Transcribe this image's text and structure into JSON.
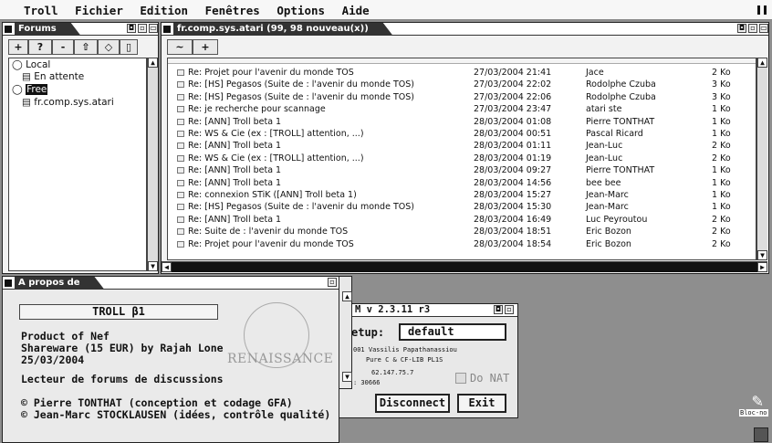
{
  "menubar": {
    "items": [
      "Troll",
      "Fichier",
      "Edition",
      "Fenêtres",
      "Options",
      "Aide"
    ]
  },
  "forums_window": {
    "title": "Forums",
    "toolbar": [
      "+",
      "?",
      "-"
    ],
    "tree": [
      "Local",
      "En attente",
      "Free",
      "fr.comp.sys.atari"
    ]
  },
  "list_window": {
    "title": "fr.comp.sys.atari (99, 98 nouveau(x))",
    "toolbar": [
      "~",
      "+"
    ],
    "rows": [
      {
        "subject": "Re: Projet pour l'avenir du monde TOS",
        "date": "27/03/2004 21:41",
        "author": "Jace",
        "size": "2 Ko"
      },
      {
        "subject": "Re: [HS] Pegasos (Suite de : l'avenir du monde TOS)",
        "date": "27/03/2004 22:02",
        "author": "Rodolphe Czuba",
        "size": "3 Ko"
      },
      {
        "subject": "Re: [HS] Pegasos (Suite de : l'avenir du monde TOS)",
        "date": "27/03/2004 22:06",
        "author": "Rodolphe Czuba",
        "size": "3 Ko"
      },
      {
        "subject": "Re: je recherche pour scannage",
        "date": "27/03/2004 23:47",
        "author": "atari ste",
        "size": "1 Ko"
      },
      {
        "subject": "Re: [ANN] Troll beta 1",
        "date": "28/03/2004 01:08",
        "author": "Pierre TONTHAT",
        "size": "1 Ko"
      },
      {
        "subject": "Re: WS & Cie (ex : [TROLL] attention, ...)",
        "date": "28/03/2004 00:51",
        "author": "Pascal Ricard",
        "size": "1 Ko"
      },
      {
        "subject": "Re: [ANN] Troll beta 1",
        "date": "28/03/2004 01:11",
        "author": "Jean-Luc",
        "size": "2 Ko"
      },
      {
        "subject": "Re: WS & Cie (ex : [TROLL] attention, ...)",
        "date": "28/03/2004 01:19",
        "author": "Jean-Luc",
        "size": "2 Ko"
      },
      {
        "subject": "Re: [ANN] Troll beta 1",
        "date": "28/03/2004 09:27",
        "author": "Pierre TONTHAT",
        "size": "1 Ko"
      },
      {
        "subject": "Re: [ANN] Troll beta 1",
        "date": "28/03/2004 14:56",
        "author": "bee bee",
        "size": "1 Ko"
      },
      {
        "subject": "Re: connexion STiK ([ANN] Troll beta 1)",
        "date": "28/03/2004 15:27",
        "author": "Jean-Marc",
        "size": "1 Ko"
      },
      {
        "subject": "Re: [HS] Pegasos (Suite de : l'avenir du monde TOS)",
        "date": "28/03/2004 15:30",
        "author": "Jean-Marc",
        "size": "1 Ko"
      },
      {
        "subject": "Re: [ANN] Troll beta 1",
        "date": "28/03/2004 16:49",
        "author": "Luc Peyroutou",
        "size": "2 Ko"
      },
      {
        "subject": "Re: Suite de : l'avenir du monde TOS",
        "date": "28/03/2004 18:51",
        "author": "Eric Bozon",
        "size": "2 Ko"
      },
      {
        "subject": "Re: Projet pour l'avenir du monde TOS",
        "date": "28/03/2004 18:54",
        "author": "Eric Bozon",
        "size": "2 Ko"
      }
    ]
  },
  "about_window": {
    "title": "A propos de",
    "version": "TROLL β1",
    "lines": [
      "Product of Nef",
      "Shareware (15 EUR) by Rajah Lone",
      "25/03/2004",
      "Lecteur de forums de discussions",
      "© Pierre TONTHAT (conception et codage GFA)",
      "© Jean-Marc STOCKLAUSEN (idées, contrôle qualité)"
    ],
    "logo_text": "RENAISSANCE"
  },
  "conn_window": {
    "title": "M v 2.3.11 r3",
    "setup_label": "etup:",
    "setup_value": "default",
    "info_lines": [
      "001 Vassilis Papathanassiou",
      "Pure C & CF-LIB PL1S",
      "62.147.75.7",
      ": 30666"
    ],
    "do_nat": "Do NAT",
    "disconnect_partial": "nnect",
    "disconnect": "Disconnect",
    "exit": "Exit"
  },
  "desktop": {
    "icon_label": "Bloc-no"
  },
  "colors": {
    "desktop": "#8e8e8e",
    "title_active": "#333333",
    "window_bg": "#f2f2f2"
  }
}
